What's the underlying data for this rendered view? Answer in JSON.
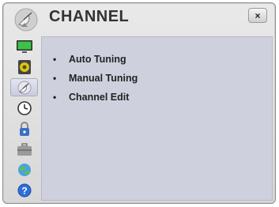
{
  "header": {
    "title": "CHANNEL",
    "close_label": "×"
  },
  "sidebar": {
    "items": [
      {
        "icon": "picture-icon",
        "active": false
      },
      {
        "icon": "audio-icon",
        "active": false
      },
      {
        "icon": "channel-icon",
        "active": true
      },
      {
        "icon": "time-icon",
        "active": false
      },
      {
        "icon": "lock-icon",
        "active": false
      },
      {
        "icon": "option-icon",
        "active": false
      },
      {
        "icon": "network-icon",
        "active": false
      },
      {
        "icon": "support-icon",
        "active": false
      }
    ]
  },
  "menu": {
    "bullet": "•",
    "items": [
      {
        "label": "Auto Tuning"
      },
      {
        "label": "Manual Tuning"
      },
      {
        "label": "Channel Edit"
      }
    ]
  }
}
